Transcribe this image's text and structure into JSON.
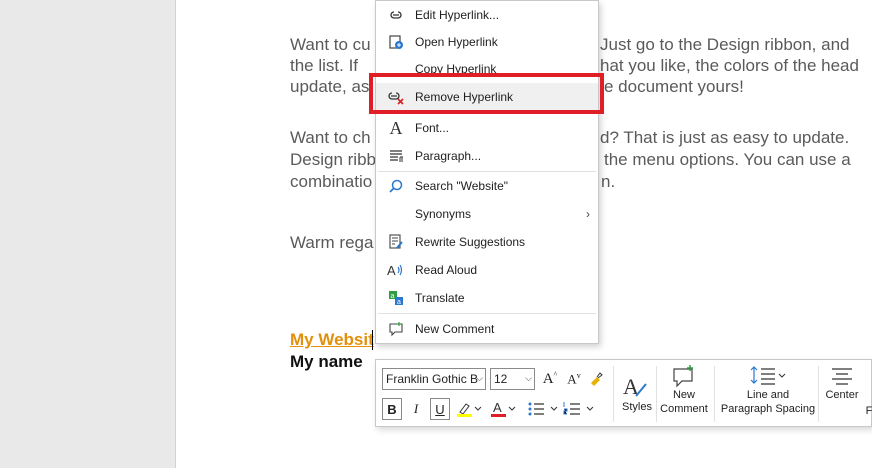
{
  "document": {
    "lines": [
      "Want to cu",
      "Just go to the Design ribbon, and",
      "the list.  If",
      "hat you like, the colors of the head",
      "update, as",
      "e document yours!",
      "Want to ch",
      "d?  That is just as easy to update.",
      "Design ribb",
      "the menu options.  You can use a",
      "combinatio",
      "n.",
      "Warm rega"
    ],
    "link_text": "My Websit",
    "name_text": "My name"
  },
  "context_menu": {
    "items": [
      {
        "label": "Edit Hyperlink...",
        "icon": "edit-hyperlink-icon"
      },
      {
        "label": "Open Hyperlink",
        "icon": "open-hyperlink-icon"
      },
      {
        "label": "Copy Hyperlink",
        "icon": ""
      },
      {
        "label": "Remove Hyperlink",
        "icon": "remove-hyperlink-icon"
      },
      {
        "label": "Font...",
        "icon": "font-icon"
      },
      {
        "label": "Paragraph...",
        "icon": "paragraph-icon"
      },
      {
        "label": "Search \"Website\"",
        "icon": "search-icon"
      },
      {
        "label": "Synonyms",
        "icon": ""
      },
      {
        "label": "Rewrite Suggestions",
        "icon": "rewrite-icon"
      },
      {
        "label": "Read Aloud",
        "icon": "read-aloud-icon"
      },
      {
        "label": "Translate",
        "icon": "translate-icon"
      },
      {
        "label": "New Comment",
        "icon": "comment-icon"
      }
    ],
    "highlight_color": "#e01e25"
  },
  "mini_toolbar": {
    "font_name": "Franklin Gothic B",
    "font_size": "12",
    "bold": "B",
    "italic": "I",
    "underline": "U",
    "styles_label": "Styles",
    "new_comment_label": "New\nComment",
    "new_comment_line1": "New",
    "new_comment_line2": "Comment",
    "line_spacing_line1": "Line and",
    "line_spacing_line2": "Paragraph Spacing",
    "center_label": "Center",
    "cut_off_label": "F"
  },
  "colors": {
    "link": "#e2900c",
    "font_color_bar": "#e01e25",
    "highlight_bar": "#ffff00"
  }
}
